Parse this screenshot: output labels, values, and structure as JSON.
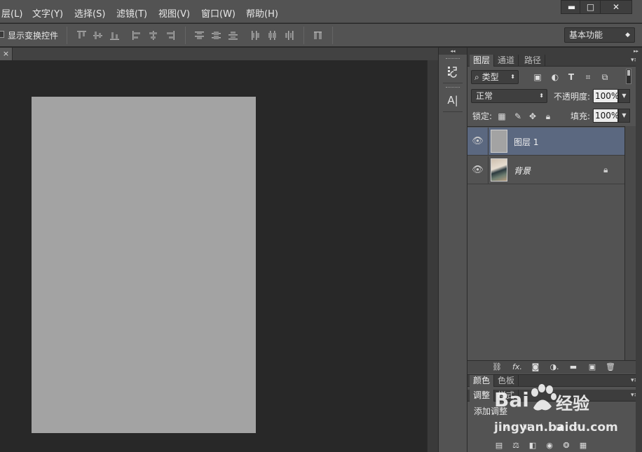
{
  "menubar": {
    "items": [
      "层(L)",
      "文字(Y)",
      "选择(S)",
      "滤镜(T)",
      "视图(V)",
      "窗口(W)",
      "帮助(H)"
    ],
    "window_buttons": {
      "minimize": "▬",
      "maximize": "□",
      "close": "✕"
    }
  },
  "options_bar": {
    "show_transform_controls": "显示变换控件",
    "show_transform_checked": false,
    "workspace": "基本功能"
  },
  "document": {
    "close_tab": "×",
    "sheet_color": "#a3a3a3"
  },
  "dock": {
    "collapse_arrows": "◂◂",
    "tools": [
      {
        "icon": "history-icon",
        "glyph": "☷"
      },
      {
        "icon": "character-icon",
        "glyph": "A|"
      }
    ]
  },
  "layers_panel": {
    "collapse_arrows": "▸▸",
    "tabs": [
      "图层",
      "通道",
      "路径"
    ],
    "active_tab": "图层",
    "panel_menu": "▾≡",
    "filter_kind": "类型",
    "filter_search_glyph": "⌕",
    "filter_icons": [
      {
        "icon": "pixel-filter-icon",
        "glyph": "▣"
      },
      {
        "icon": "adjustment-filter-icon",
        "glyph": "◐"
      },
      {
        "icon": "type-filter-icon",
        "glyph": "T"
      },
      {
        "icon": "shape-filter-icon",
        "glyph": "⌗"
      },
      {
        "icon": "smart-object-filter-icon",
        "glyph": "⧉"
      }
    ],
    "blend_mode": "正常",
    "opacity_label": "不透明度:",
    "opacity_value": "100%",
    "lock_label": "锁定:",
    "lock_icons": [
      {
        "icon": "lock-transparent-icon",
        "glyph": "▦"
      },
      {
        "icon": "lock-pixels-icon",
        "glyph": "✎"
      },
      {
        "icon": "lock-position-icon",
        "glyph": "✥"
      },
      {
        "icon": "lock-all-icon",
        "glyph": "🔒︎"
      }
    ],
    "fill_label": "填充:",
    "fill_value": "100%",
    "layers": [
      {
        "name": "图层 1",
        "selected": true,
        "visible_glyph": "👁︎",
        "thumb": "gray",
        "locked": false
      },
      {
        "name": "背景",
        "selected": false,
        "visible_glyph": "👁︎",
        "thumb": "photo",
        "locked": true,
        "lock_glyph": "🔒︎"
      }
    ],
    "footer_icons": [
      {
        "icon": "link-layers-icon",
        "glyph": "⛓"
      },
      {
        "icon": "layer-style-icon",
        "glyph": "fx."
      },
      {
        "icon": "layer-mask-icon",
        "glyph": "◙"
      },
      {
        "icon": "new-adjustment-icon",
        "glyph": "◑."
      },
      {
        "icon": "new-group-icon",
        "glyph": "▬"
      },
      {
        "icon": "new-layer-icon",
        "glyph": "▣"
      },
      {
        "icon": "delete-layer-icon",
        "glyph": "🗑︎"
      }
    ]
  },
  "color_panel": {
    "tabs": [
      "颜色",
      "色板"
    ],
    "active_tab": "颜色",
    "panel_menu": "▾≡"
  },
  "adjustments_panel": {
    "tabs": [
      "调整",
      "样式"
    ],
    "active_tab": "调整",
    "panel_menu": "▾≡",
    "add_adjustment_label": "添加调整",
    "row1_icons": [
      {
        "icon": "brightness-icon",
        "glyph": "☼"
      },
      {
        "icon": "levels-icon",
        "glyph": "ılıl"
      },
      {
        "icon": "curves-icon",
        "glyph": "⌇"
      },
      {
        "icon": "exposure-icon",
        "glyph": "◪"
      },
      {
        "icon": "vibrance-icon",
        "glyph": "▽"
      }
    ],
    "row2_icons": [
      {
        "icon": "hue-saturation-icon",
        "glyph": "▤"
      },
      {
        "icon": "color-balance-icon",
        "glyph": "⚖"
      },
      {
        "icon": "black-white-icon",
        "glyph": "◧"
      },
      {
        "icon": "photo-filter-icon",
        "glyph": "◉"
      },
      {
        "icon": "channel-mixer-icon",
        "glyph": "❂"
      },
      {
        "icon": "color-lookup-icon",
        "glyph": "▦"
      }
    ]
  },
  "watermark": {
    "brand_left": "Bai",
    "brand_right": "经验",
    "url": "jingyan.baidu.com"
  }
}
